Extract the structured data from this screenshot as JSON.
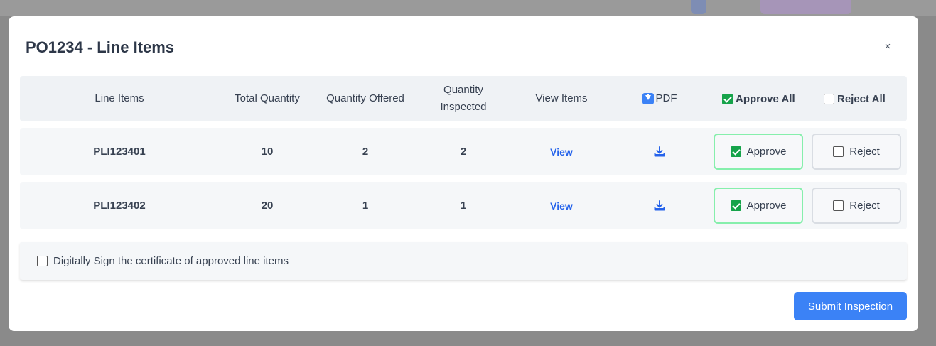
{
  "modal": {
    "title": "PO1234 - Line Items",
    "close_label": "×"
  },
  "table": {
    "headers": {
      "line_items": "Line Items",
      "total_quantity": "Total Quantity",
      "quantity_offered": "Quantity Offered",
      "quantity_inspected_line1": "Quantity",
      "quantity_inspected_line2": "Inspected",
      "view_items": "View Items",
      "pdf": "PDF",
      "approve_all": "Approve All",
      "reject_all": "Reject All"
    },
    "header_checks": {
      "approve_all_checked": true,
      "reject_all_checked": false
    },
    "rows": [
      {
        "line_item": "PLI123401",
        "total_quantity": "10",
        "quantity_offered": "2",
        "quantity_inspected": "2",
        "view_label": "View",
        "approve_label": "Approve",
        "approve_checked": true,
        "reject_label": "Reject",
        "reject_checked": false
      },
      {
        "line_item": "PLI123402",
        "total_quantity": "20",
        "quantity_offered": "1",
        "quantity_inspected": "1",
        "view_label": "View",
        "approve_label": "Approve",
        "approve_checked": true,
        "reject_label": "Reject",
        "reject_checked": false
      }
    ]
  },
  "sign": {
    "label": "Digitally Sign the certificate of approved line items",
    "checked": false
  },
  "submit_label": "Submit Inspection",
  "colors": {
    "accent": "#3b82f6",
    "approve_green": "#16a34a",
    "link_blue": "#2563eb"
  }
}
